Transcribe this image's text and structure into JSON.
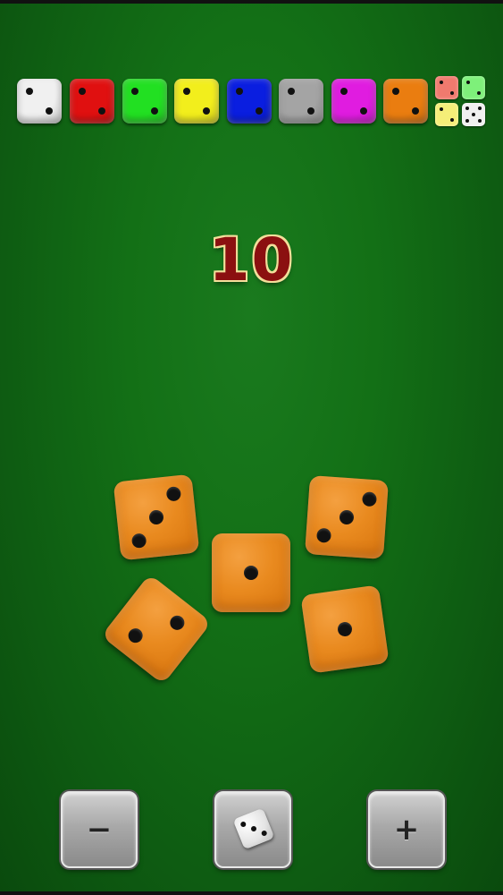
{
  "total": {
    "value": "10"
  },
  "palette": [
    {
      "name": "white",
      "color": "#f0f0f0"
    },
    {
      "name": "red",
      "color": "#e01010"
    },
    {
      "name": "green",
      "color": "#22e022"
    },
    {
      "name": "yellow",
      "color": "#f2ee1c"
    },
    {
      "name": "blue",
      "color": "#0a1ee0"
    },
    {
      "name": "gray",
      "color": "#a4a4a4"
    },
    {
      "name": "magenta",
      "color": "#e01ce0"
    },
    {
      "name": "orange",
      "color": "#ea7d10"
    },
    {
      "name": "mixed",
      "colors": [
        "#f07a6e",
        "#7ef07a",
        "#f5ee78",
        "#f0f0f0"
      ]
    }
  ],
  "dice": [
    {
      "face": 3,
      "color": "#ea8a1f"
    },
    {
      "face": 3,
      "color": "#ea8a1f"
    },
    {
      "face": 1,
      "color": "#ea8a1f"
    },
    {
      "face": 2,
      "color": "#ea8a1f"
    },
    {
      "face": 1,
      "color": "#ea8a1f"
    }
  ],
  "controls": {
    "minus_label": "−",
    "plus_label": "+",
    "roll_icon": "die-icon"
  }
}
